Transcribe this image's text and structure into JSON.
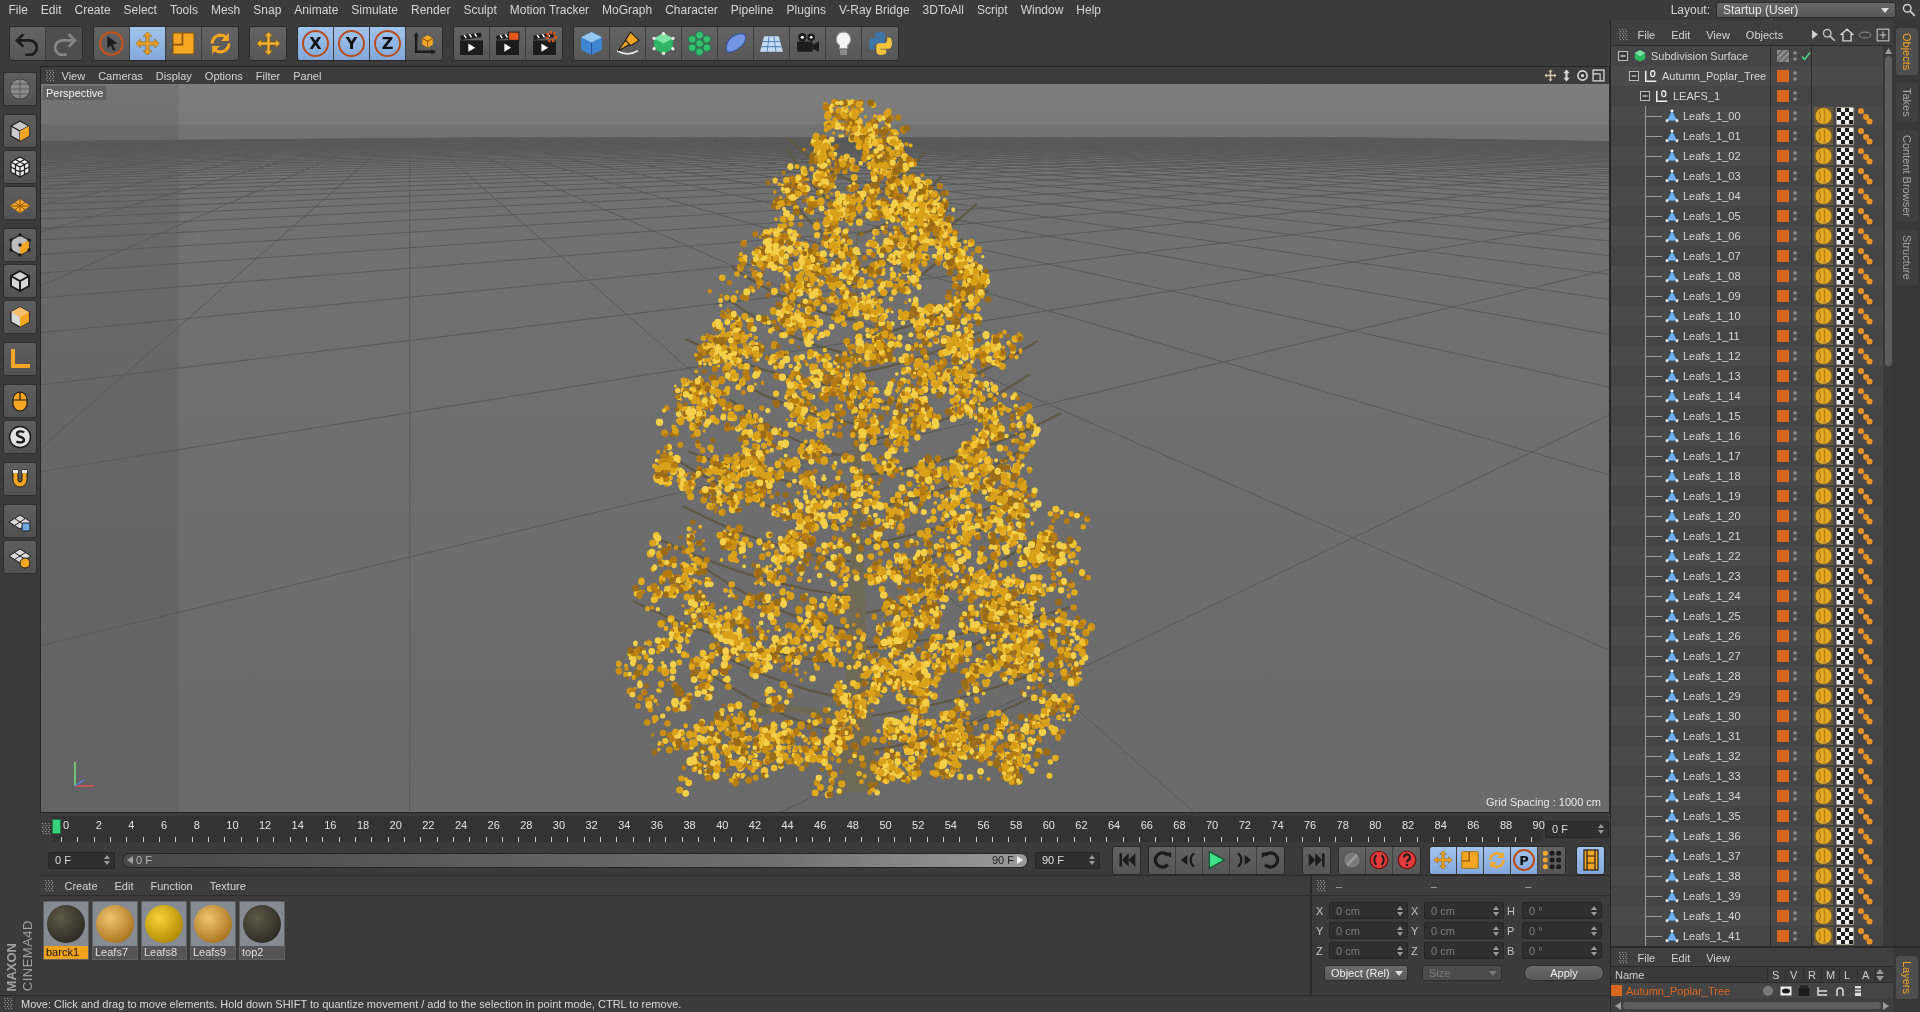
{
  "menu_bar": {
    "items": [
      "File",
      "Edit",
      "Create",
      "Select",
      "Tools",
      "Mesh",
      "Snap",
      "Animate",
      "Simulate",
      "Render",
      "Sculpt",
      "Motion Tracker",
      "MoGraph",
      "Character",
      "Pipeline",
      "Plugins",
      "V-Ray Bridge",
      "3DToAll",
      "Script",
      "Window",
      "Help"
    ],
    "layout_label": "Layout:",
    "layout_value": "Startup (User)"
  },
  "toolbar": {
    "groups": [
      [
        {
          "kind": "undo",
          "selected": false,
          "disabled": false
        },
        {
          "kind": "redo",
          "selected": false,
          "disabled": true
        }
      ],
      [
        {
          "kind": "select",
          "selected": false,
          "disabled": false
        },
        {
          "kind": "move",
          "selected": true,
          "disabled": false
        },
        {
          "kind": "scale",
          "selected": false,
          "disabled": false
        },
        {
          "kind": "rotate",
          "selected": false,
          "disabled": false
        }
      ],
      [
        {
          "kind": "recent",
          "selected": false,
          "disabled": false
        }
      ],
      [
        {
          "kind": "axis",
          "label": "X",
          "selected": true,
          "disabled": false
        },
        {
          "kind": "axis",
          "label": "Y",
          "selected": true,
          "disabled": false
        },
        {
          "kind": "axis",
          "label": "Z",
          "selected": true,
          "disabled": false
        },
        {
          "kind": "coordsystem",
          "selected": false,
          "disabled": false
        }
      ],
      [
        {
          "kind": "renderview",
          "selected": false,
          "disabled": false
        },
        {
          "kind": "renderpicture",
          "selected": false,
          "disabled": false
        },
        {
          "kind": "rendersettings",
          "selected": false,
          "disabled": false
        }
      ],
      [
        {
          "kind": "cube",
          "selected": false,
          "disabled": false
        },
        {
          "kind": "pen",
          "selected": false,
          "disabled": false
        },
        {
          "kind": "subdivision",
          "selected": false,
          "disabled": false
        },
        {
          "kind": "cloner",
          "selected": false,
          "disabled": false
        },
        {
          "kind": "deformer",
          "selected": false,
          "disabled": false
        },
        {
          "kind": "floor",
          "selected": false,
          "disabled": false
        },
        {
          "kind": "camera",
          "selected": false,
          "disabled": false
        },
        {
          "kind": "light",
          "selected": false,
          "disabled": false
        },
        {
          "kind": "python",
          "selected": false,
          "disabled": false
        }
      ]
    ]
  },
  "viewport": {
    "menu": [
      "View",
      "Cameras",
      "Display",
      "Options",
      "Filter",
      "Panel"
    ],
    "camera_label": "Perspective",
    "grid_label": "Grid Spacing : 1000 cm"
  },
  "timeline": {
    "ticks": [
      "0",
      "2",
      "4",
      "6",
      "8",
      "10",
      "12",
      "14",
      "16",
      "18",
      "20",
      "22",
      "24",
      "26",
      "28",
      "30",
      "32",
      "34",
      "36",
      "38",
      "40",
      "42",
      "44",
      "46",
      "48",
      "50",
      "52",
      "54",
      "56",
      "58",
      "60",
      "62",
      "64",
      "66",
      "68",
      "70",
      "72",
      "74",
      "76",
      "78",
      "80",
      "82",
      "84",
      "86",
      "88",
      "90"
    ],
    "playhead": {
      "level": 0
    },
    "frame_field": "0 F",
    "start_field": "0 F",
    "range_bar": {
      "level": 1,
      "start_label": "0 F",
      "end_label": "90 F"
    },
    "end_field": "90 F",
    "key_modes": [
      {
        "kind": "position",
        "selected": true
      },
      {
        "kind": "scale",
        "selected": true
      },
      {
        "kind": "rotation",
        "selected": true
      },
      {
        "kind": "parameter",
        "label": "P",
        "selected": true
      },
      {
        "kind": "pla",
        "selected": false
      }
    ],
    "film_button": {
      "selected": true
    }
  },
  "materials": {
    "menu": [
      "Create",
      "Edit",
      "Function",
      "Texture"
    ],
    "items": [
      {
        "name": "barck1",
        "kind": "bark",
        "selected": true
      },
      {
        "name": "Leafs7",
        "kind": "leaf",
        "selected": false
      },
      {
        "name": "Leafs8",
        "kind": "gold",
        "selected": false
      },
      {
        "name": "Leafs9",
        "kind": "leaf",
        "selected": false
      },
      {
        "name": "top2",
        "kind": "bark",
        "selected": false
      }
    ]
  },
  "coordinates": {
    "headers": [
      "–",
      "–",
      "–"
    ],
    "columns": [
      [
        {
          "axis": "X",
          "value": "0 cm",
          "disabled": true
        },
        {
          "axis": "Y",
          "value": "0 cm",
          "disabled": true
        },
        {
          "axis": "Z",
          "value": "0 cm",
          "disabled": true
        }
      ],
      [
        {
          "axis": "X",
          "value": "0 cm",
          "disabled": true
        },
        {
          "axis": "Y",
          "value": "0 cm",
          "disabled": true
        },
        {
          "axis": "Z",
          "value": "0 cm",
          "disabled": true
        }
      ],
      [
        {
          "axis": "H",
          "value": "0 °",
          "disabled": true
        },
        {
          "axis": "P",
          "value": "0 °",
          "disabled": true
        },
        {
          "axis": "B",
          "value": "0 °",
          "disabled": true
        }
      ]
    ],
    "mode_dropdown": {
      "value": "Object (Rel)",
      "disabled": false
    },
    "size_dropdown": {
      "value": "Size",
      "disabled": true
    },
    "apply_button": "Apply"
  },
  "status_bar": {
    "text": "Move: Click and drag to move elements. Hold down SHIFT to quantize movement / add to the selection in point mode, CTRL to remove."
  },
  "logo": {
    "brand": "MAXON",
    "product": "CINEMA4D"
  },
  "objects_panel": {
    "menu": [
      "File",
      "Edit",
      "View",
      "Objects"
    ],
    "tabs": [
      {
        "label": "Objects",
        "selected": true
      },
      {
        "label": "Takes",
        "selected": false
      },
      {
        "label": "Content Browser",
        "selected": false
      },
      {
        "label": "Structure",
        "selected": false
      }
    ],
    "tree": [
      {
        "name": "Subdivision Surface",
        "kind": "subdivision",
        "expanded": true,
        "enabled": true,
        "children": [
          {
            "name": "Autumn_Poplar_Tree",
            "kind": "null",
            "expanded": true,
            "color": "#d9661f",
            "children": [
              {
                "name": "LEAFS_1",
                "kind": "null",
                "expanded": true,
                "color": "#d9661f",
                "children": [
                  {
                    "name": "Leafs_1_00",
                    "kind": "polygon",
                    "color": "#d9661f",
                    "tags": [
                      {
                        "kind": "material"
                      },
                      {
                        "kind": "uvw"
                      },
                      {
                        "kind": "selection"
                      }
                    ]
                  },
                  {
                    "name": "Leafs_1_01",
                    "kind": "polygon",
                    "color": "#d9661f",
                    "tags": [
                      {
                        "kind": "material"
                      },
                      {
                        "kind": "uvw"
                      },
                      {
                        "kind": "selection"
                      }
                    ]
                  },
                  {
                    "name": "Leafs_1_02",
                    "kind": "polygon",
                    "color": "#d9661f",
                    "tags": [
                      {
                        "kind": "material"
                      },
                      {
                        "kind": "uvw"
                      },
                      {
                        "kind": "selection"
                      }
                    ]
                  },
                  {
                    "name": "Leafs_1_03",
                    "kind": "polygon",
                    "color": "#d9661f",
                    "tags": [
                      {
                        "kind": "material"
                      },
                      {
                        "kind": "uvw"
                      },
                      {
                        "kind": "selection"
                      }
                    ]
                  },
                  {
                    "name": "Leafs_1_04",
                    "kind": "polygon",
                    "color": "#d9661f",
                    "tags": [
                      {
                        "kind": "material"
                      },
                      {
                        "kind": "uvw"
                      },
                      {
                        "kind": "selection"
                      }
                    ]
                  },
                  {
                    "name": "Leafs_1_05",
                    "kind": "polygon",
                    "color": "#d9661f",
                    "tags": [
                      {
                        "kind": "material"
                      },
                      {
                        "kind": "uvw"
                      },
                      {
                        "kind": "selection"
                      }
                    ]
                  },
                  {
                    "name": "Leafs_1_06",
                    "kind": "polygon",
                    "color": "#d9661f",
                    "tags": [
                      {
                        "kind": "material"
                      },
                      {
                        "kind": "uvw"
                      },
                      {
                        "kind": "selection"
                      }
                    ]
                  },
                  {
                    "name": "Leafs_1_07",
                    "kind": "polygon",
                    "color": "#d9661f",
                    "tags": [
                      {
                        "kind": "material"
                      },
                      {
                        "kind": "uvw"
                      },
                      {
                        "kind": "selection"
                      }
                    ]
                  },
                  {
                    "name": "Leafs_1_08",
                    "kind": "polygon",
                    "color": "#d9661f",
                    "tags": [
                      {
                        "kind": "material"
                      },
                      {
                        "kind": "uvw"
                      },
                      {
                        "kind": "selection"
                      }
                    ]
                  },
                  {
                    "name": "Leafs_1_09",
                    "kind": "polygon",
                    "color": "#d9661f",
                    "tags": [
                      {
                        "kind": "material"
                      },
                      {
                        "kind": "uvw"
                      },
                      {
                        "kind": "selection"
                      }
                    ]
                  },
                  {
                    "name": "Leafs_1_10",
                    "kind": "polygon",
                    "color": "#d9661f",
                    "tags": [
                      {
                        "kind": "material"
                      },
                      {
                        "kind": "uvw"
                      },
                      {
                        "kind": "selection"
                      }
                    ]
                  },
                  {
                    "name": "Leafs_1_11",
                    "kind": "polygon",
                    "color": "#d9661f",
                    "tags": [
                      {
                        "kind": "material"
                      },
                      {
                        "kind": "uvw"
                      },
                      {
                        "kind": "selection"
                      }
                    ]
                  },
                  {
                    "name": "Leafs_1_12",
                    "kind": "polygon",
                    "color": "#d9661f",
                    "tags": [
                      {
                        "kind": "material"
                      },
                      {
                        "kind": "uvw"
                      },
                      {
                        "kind": "selection"
                      }
                    ]
                  },
                  {
                    "name": "Leafs_1_13",
                    "kind": "polygon",
                    "color": "#d9661f",
                    "tags": [
                      {
                        "kind": "material"
                      },
                      {
                        "kind": "uvw"
                      },
                      {
                        "kind": "selection"
                      }
                    ]
                  },
                  {
                    "name": "Leafs_1_14",
                    "kind": "polygon",
                    "color": "#d9661f",
                    "tags": [
                      {
                        "kind": "material"
                      },
                      {
                        "kind": "uvw"
                      },
                      {
                        "kind": "selection"
                      }
                    ]
                  },
                  {
                    "name": "Leafs_1_15",
                    "kind": "polygon",
                    "color": "#d9661f",
                    "tags": [
                      {
                        "kind": "material"
                      },
                      {
                        "kind": "uvw"
                      },
                      {
                        "kind": "selection"
                      }
                    ]
                  },
                  {
                    "name": "Leafs_1_16",
                    "kind": "polygon",
                    "color": "#d9661f",
                    "tags": [
                      {
                        "kind": "material"
                      },
                      {
                        "kind": "uvw"
                      },
                      {
                        "kind": "selection"
                      }
                    ]
                  },
                  {
                    "name": "Leafs_1_17",
                    "kind": "polygon",
                    "color": "#d9661f",
                    "tags": [
                      {
                        "kind": "material"
                      },
                      {
                        "kind": "uvw"
                      },
                      {
                        "kind": "selection"
                      }
                    ]
                  },
                  {
                    "name": "Leafs_1_18",
                    "kind": "polygon",
                    "color": "#d9661f",
                    "tags": [
                      {
                        "kind": "material"
                      },
                      {
                        "kind": "uvw"
                      },
                      {
                        "kind": "selection"
                      }
                    ]
                  },
                  {
                    "name": "Leafs_1_19",
                    "kind": "polygon",
                    "color": "#d9661f",
                    "tags": [
                      {
                        "kind": "material"
                      },
                      {
                        "kind": "uvw"
                      },
                      {
                        "kind": "selection"
                      }
                    ]
                  },
                  {
                    "name": "Leafs_1_20",
                    "kind": "polygon",
                    "color": "#d9661f",
                    "tags": [
                      {
                        "kind": "material"
                      },
                      {
                        "kind": "uvw"
                      },
                      {
                        "kind": "selection"
                      }
                    ]
                  },
                  {
                    "name": "Leafs_1_21",
                    "kind": "polygon",
                    "color": "#d9661f",
                    "tags": [
                      {
                        "kind": "material"
                      },
                      {
                        "kind": "uvw"
                      },
                      {
                        "kind": "selection"
                      }
                    ]
                  },
                  {
                    "name": "Leafs_1_22",
                    "kind": "polygon",
                    "color": "#d9661f",
                    "tags": [
                      {
                        "kind": "material"
                      },
                      {
                        "kind": "uvw"
                      },
                      {
                        "kind": "selection"
                      }
                    ]
                  },
                  {
                    "name": "Leafs_1_23",
                    "kind": "polygon",
                    "color": "#d9661f",
                    "tags": [
                      {
                        "kind": "material"
                      },
                      {
                        "kind": "uvw"
                      },
                      {
                        "kind": "selection"
                      }
                    ]
                  },
                  {
                    "name": "Leafs_1_24",
                    "kind": "polygon",
                    "color": "#d9661f",
                    "tags": [
                      {
                        "kind": "material"
                      },
                      {
                        "kind": "uvw"
                      },
                      {
                        "kind": "selection"
                      }
                    ]
                  },
                  {
                    "name": "Leafs_1_25",
                    "kind": "polygon",
                    "color": "#d9661f",
                    "tags": [
                      {
                        "kind": "material"
                      },
                      {
                        "kind": "uvw"
                      },
                      {
                        "kind": "selection"
                      }
                    ]
                  },
                  {
                    "name": "Leafs_1_26",
                    "kind": "polygon",
                    "color": "#d9661f",
                    "tags": [
                      {
                        "kind": "material"
                      },
                      {
                        "kind": "uvw"
                      },
                      {
                        "kind": "selection"
                      }
                    ]
                  },
                  {
                    "name": "Leafs_1_27",
                    "kind": "polygon",
                    "color": "#d9661f",
                    "tags": [
                      {
                        "kind": "material"
                      },
                      {
                        "kind": "uvw"
                      },
                      {
                        "kind": "selection"
                      }
                    ]
                  },
                  {
                    "name": "Leafs_1_28",
                    "kind": "polygon",
                    "color": "#d9661f",
                    "tags": [
                      {
                        "kind": "material"
                      },
                      {
                        "kind": "uvw"
                      },
                      {
                        "kind": "selection"
                      }
                    ]
                  },
                  {
                    "name": "Leafs_1_29",
                    "kind": "polygon",
                    "color": "#d9661f",
                    "tags": [
                      {
                        "kind": "material"
                      },
                      {
                        "kind": "uvw"
                      },
                      {
                        "kind": "selection"
                      }
                    ]
                  },
                  {
                    "name": "Leafs_1_30",
                    "kind": "polygon",
                    "color": "#d9661f",
                    "tags": [
                      {
                        "kind": "material"
                      },
                      {
                        "kind": "uvw"
                      },
                      {
                        "kind": "selection"
                      }
                    ]
                  },
                  {
                    "name": "Leafs_1_31",
                    "kind": "polygon",
                    "color": "#d9661f",
                    "tags": [
                      {
                        "kind": "material"
                      },
                      {
                        "kind": "uvw"
                      },
                      {
                        "kind": "selection"
                      }
                    ]
                  },
                  {
                    "name": "Leafs_1_32",
                    "kind": "polygon",
                    "color": "#d9661f",
                    "tags": [
                      {
                        "kind": "material"
                      },
                      {
                        "kind": "uvw"
                      },
                      {
                        "kind": "selection"
                      }
                    ]
                  },
                  {
                    "name": "Leafs_1_33",
                    "kind": "polygon",
                    "color": "#d9661f",
                    "tags": [
                      {
                        "kind": "material"
                      },
                      {
                        "kind": "uvw"
                      },
                      {
                        "kind": "selection"
                      }
                    ]
                  },
                  {
                    "name": "Leafs_1_34",
                    "kind": "polygon",
                    "color": "#d9661f",
                    "tags": [
                      {
                        "kind": "material"
                      },
                      {
                        "kind": "uvw"
                      },
                      {
                        "kind": "selection"
                      }
                    ]
                  },
                  {
                    "name": "Leafs_1_35",
                    "kind": "polygon",
                    "color": "#d9661f",
                    "tags": [
                      {
                        "kind": "material"
                      },
                      {
                        "kind": "uvw"
                      },
                      {
                        "kind": "selection"
                      }
                    ]
                  },
                  {
                    "name": "Leafs_1_36",
                    "kind": "polygon",
                    "color": "#d9661f",
                    "tags": [
                      {
                        "kind": "material"
                      },
                      {
                        "kind": "uvw"
                      },
                      {
                        "kind": "selection"
                      }
                    ]
                  },
                  {
                    "name": "Leafs_1_37",
                    "kind": "polygon",
                    "color": "#d9661f",
                    "tags": [
                      {
                        "kind": "material"
                      },
                      {
                        "kind": "uvw"
                      },
                      {
                        "kind": "selection"
                      }
                    ]
                  },
                  {
                    "name": "Leafs_1_38",
                    "kind": "polygon",
                    "color": "#d9661f",
                    "tags": [
                      {
                        "kind": "material"
                      },
                      {
                        "kind": "uvw"
                      },
                      {
                        "kind": "selection"
                      }
                    ]
                  },
                  {
                    "name": "Leafs_1_39",
                    "kind": "polygon",
                    "color": "#d9661f",
                    "tags": [
                      {
                        "kind": "material"
                      },
                      {
                        "kind": "uvw"
                      },
                      {
                        "kind": "selection"
                      }
                    ]
                  },
                  {
                    "name": "Leafs_1_40",
                    "kind": "polygon",
                    "color": "#d9661f",
                    "tags": [
                      {
                        "kind": "material"
                      },
                      {
                        "kind": "uvw"
                      },
                      {
                        "kind": "selection"
                      }
                    ]
                  },
                  {
                    "name": "Leafs_1_41",
                    "kind": "polygon",
                    "color": "#d9661f",
                    "tags": [
                      {
                        "kind": "material"
                      },
                      {
                        "kind": "uvw"
                      },
                      {
                        "kind": "selection"
                      }
                    ]
                  }
                ]
              }
            ]
          }
        ]
      }
    ]
  },
  "layers_panel": {
    "menu": [
      "File",
      "Edit",
      "View"
    ],
    "columns": [
      "Name",
      "S",
      "V",
      "R",
      "M",
      "L",
      "A"
    ],
    "rows": [
      {
        "name": "Autumn_Poplar_Tree",
        "color": "#d9661f"
      }
    ],
    "tab": {
      "label": "Layers",
      "selected": true
    }
  }
}
